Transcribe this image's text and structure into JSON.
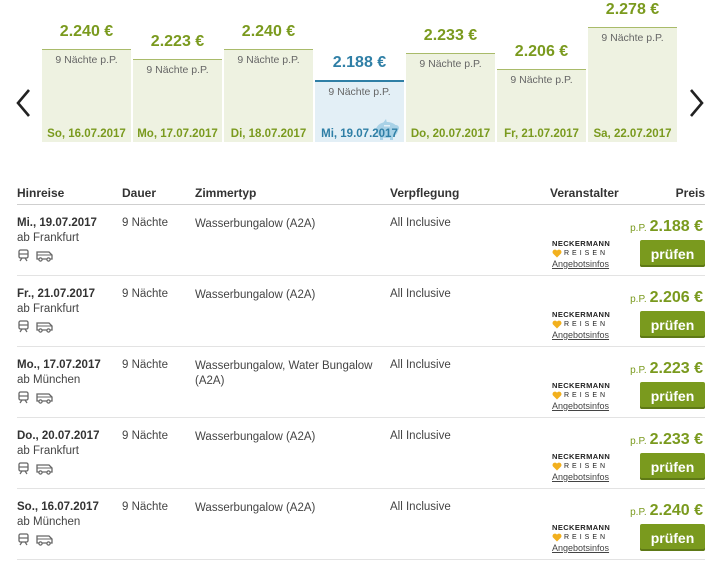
{
  "calendar": {
    "days": [
      {
        "date": "So, 16.07.2017",
        "price": "2.240 €",
        "note": "9 Nächte p.P.",
        "value": 2240,
        "selected": false
      },
      {
        "date": "Mo, 17.07.2017",
        "price": "2.223 €",
        "note": "9 Nächte p.P.",
        "value": 2223,
        "selected": false
      },
      {
        "date": "Di, 18.07.2017",
        "price": "2.240 €",
        "note": "9 Nächte p.P.",
        "value": 2240,
        "selected": false
      },
      {
        "date": "Mi, 19.07.2017",
        "price": "2.188 €",
        "note": "9 Nächte p.P.",
        "value": 2188,
        "selected": true
      },
      {
        "date": "Do, 20.07.2017",
        "price": "2.233 €",
        "note": "9 Nächte p.P.",
        "value": 2233,
        "selected": false
      },
      {
        "date": "Fr, 21.07.2017",
        "price": "2.206 €",
        "note": "9 Nächte p.P.",
        "value": 2206,
        "selected": false
      },
      {
        "date": "Sa, 22.07.2017",
        "price": "2.278 €",
        "note": "9 Nächte p.P.",
        "value": 2278,
        "selected": false
      }
    ],
    "prev_icon": "chevron-left-icon",
    "next_icon": "chevron-right-icon"
  },
  "table": {
    "headers": {
      "hinreise": "Hinreise",
      "dauer": "Dauer",
      "zimmertyp": "Zimmertyp",
      "verpflegung": "Verpflegung",
      "veranstalter": "Veranstalter",
      "preis": "Preis"
    },
    "rows": [
      {
        "date": "Mi., 19.07.2017",
        "origin": "ab Frankfurt",
        "duration": "9 Nächte",
        "room": "Wasserbungalow (A2A)",
        "board": "All Inclusive",
        "pp": "p.P.",
        "price": "2.188 €",
        "button": "prüfen"
      },
      {
        "date": "Fr., 21.07.2017",
        "origin": "ab Frankfurt",
        "duration": "9 Nächte",
        "room": "Wasserbungalow (A2A)",
        "board": "All Inclusive",
        "pp": "p.P.",
        "price": "2.206 €",
        "button": "prüfen"
      },
      {
        "date": "Mo., 17.07.2017",
        "origin": "ab München",
        "duration": "9 Nächte",
        "room": "Wasserbungalow, Water Bungalow (A2A)",
        "board": "All Inclusive",
        "pp": "p.P.",
        "price": "2.223 €",
        "button": "prüfen"
      },
      {
        "date": "Do., 20.07.2017",
        "origin": "ab Frankfurt",
        "duration": "9 Nächte",
        "room": "Wasserbungalow (A2A)",
        "board": "All Inclusive",
        "pp": "p.P.",
        "price": "2.233 €",
        "button": "prüfen"
      },
      {
        "date": "So., 16.07.2017",
        "origin": "ab München",
        "duration": "9 Nächte",
        "room": "Wasserbungalow (A2A)",
        "board": "All Inclusive",
        "pp": "p.P.",
        "price": "2.240 €",
        "button": "prüfen"
      }
    ],
    "operator": {
      "name": "NECKERMANN",
      "sub": "REISEN",
      "link": "Angebotsinfos"
    },
    "icons": [
      "train-icon",
      "bus-icon"
    ]
  },
  "colors": {
    "accent": "#7a9a1e",
    "selected": "#2f7fa6",
    "bar_bg": "#eef2e1",
    "selected_bg": "#e3eff6"
  }
}
